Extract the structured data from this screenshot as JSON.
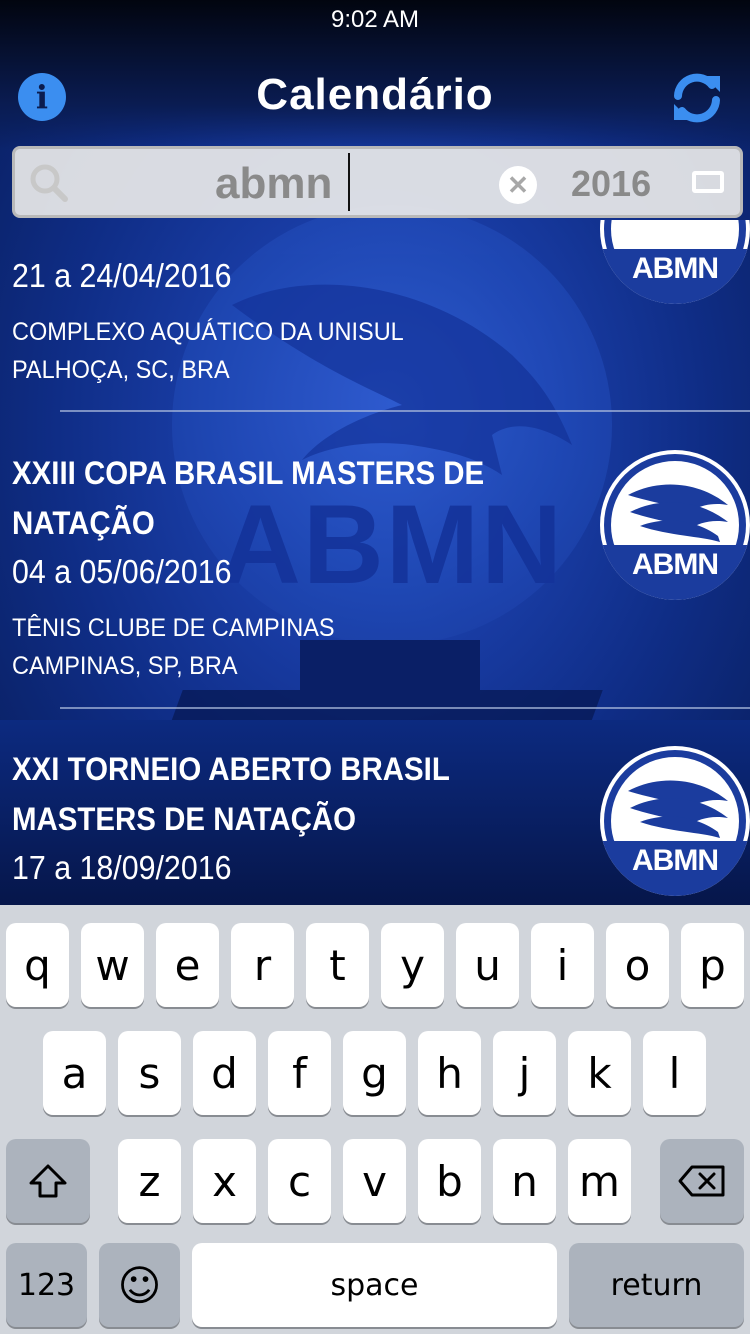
{
  "status_bar": {
    "time": "9:02 AM"
  },
  "nav": {
    "title": "Calendário",
    "info_icon": "info-icon",
    "refresh_icon": "refresh-icon"
  },
  "search": {
    "value": "abmn",
    "year": "2016"
  },
  "events": [
    {
      "name_lines": [
        "",
        ""
      ],
      "date": "21 a 24/04/2016",
      "venue": "COMPLEXO AQUÁTICO DA UNISUL",
      "city": "PALHOÇA, SC, BRA",
      "logo_label": "ABMN"
    },
    {
      "name_lines": [
        "XXIII COPA BRASIL MASTERS DE",
        "NATAÇÃO"
      ],
      "date": "04 a 05/06/2016",
      "venue": "TÊNIS CLUBE DE CAMPINAS",
      "city": "CAMPINAS, SP, BRA",
      "logo_label": "ABMN"
    },
    {
      "name_lines": [
        "XXI TORNEIO ABERTO BRASIL",
        "MASTERS DE NATAÇÃO"
      ],
      "date": "17 a 18/09/2016",
      "venue": "",
      "city": "",
      "logo_label": "ABMN"
    }
  ],
  "background": {
    "watermark": "ABMN"
  },
  "keyboard": {
    "row1": [
      "q",
      "w",
      "e",
      "r",
      "t",
      "y",
      "u",
      "i",
      "o",
      "p"
    ],
    "row2": [
      "a",
      "s",
      "d",
      "f",
      "g",
      "h",
      "j",
      "k",
      "l"
    ],
    "row3": [
      "z",
      "x",
      "c",
      "v",
      "b",
      "n",
      "m"
    ],
    "numbers_label": "123",
    "emoji_label": "☺",
    "space_label": "space",
    "return_label": "return",
    "shift_icon": "shift-icon",
    "delete_icon": "delete-icon"
  },
  "colors": {
    "accent": "#3b8ef0",
    "keyboard_bg": "#d1d5db",
    "logo_blue": "#1b3c9e"
  }
}
